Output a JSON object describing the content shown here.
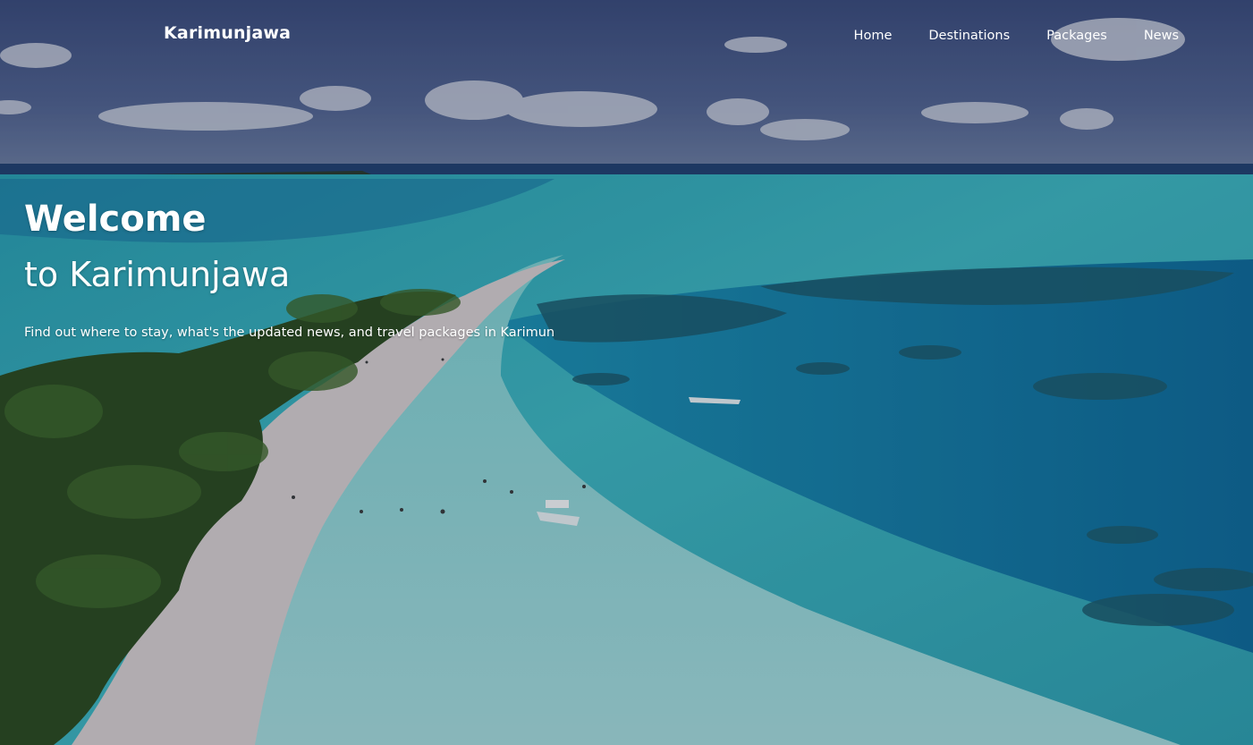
{
  "site": {
    "brand": "Karimunjawa"
  },
  "nav": {
    "items": [
      {
        "label": "Home"
      },
      {
        "label": "Destinations"
      },
      {
        "label": "Packages"
      },
      {
        "label": "News"
      }
    ]
  },
  "hero": {
    "title_line1": "Welcome",
    "title_line2": "to Karimunjawa",
    "tagline": "Find out where to stay, what's the updated news, and travel packages in Karimun",
    "image_description": "aerial-island-lagoon-photo"
  },
  "colors": {
    "text": "#ffffff",
    "sky": "#4a5a86",
    "lagoon": "#3fb5bd",
    "deep_water": "#136f99",
    "sand": "#d9cfcf",
    "foliage": "#2f4f1f"
  }
}
